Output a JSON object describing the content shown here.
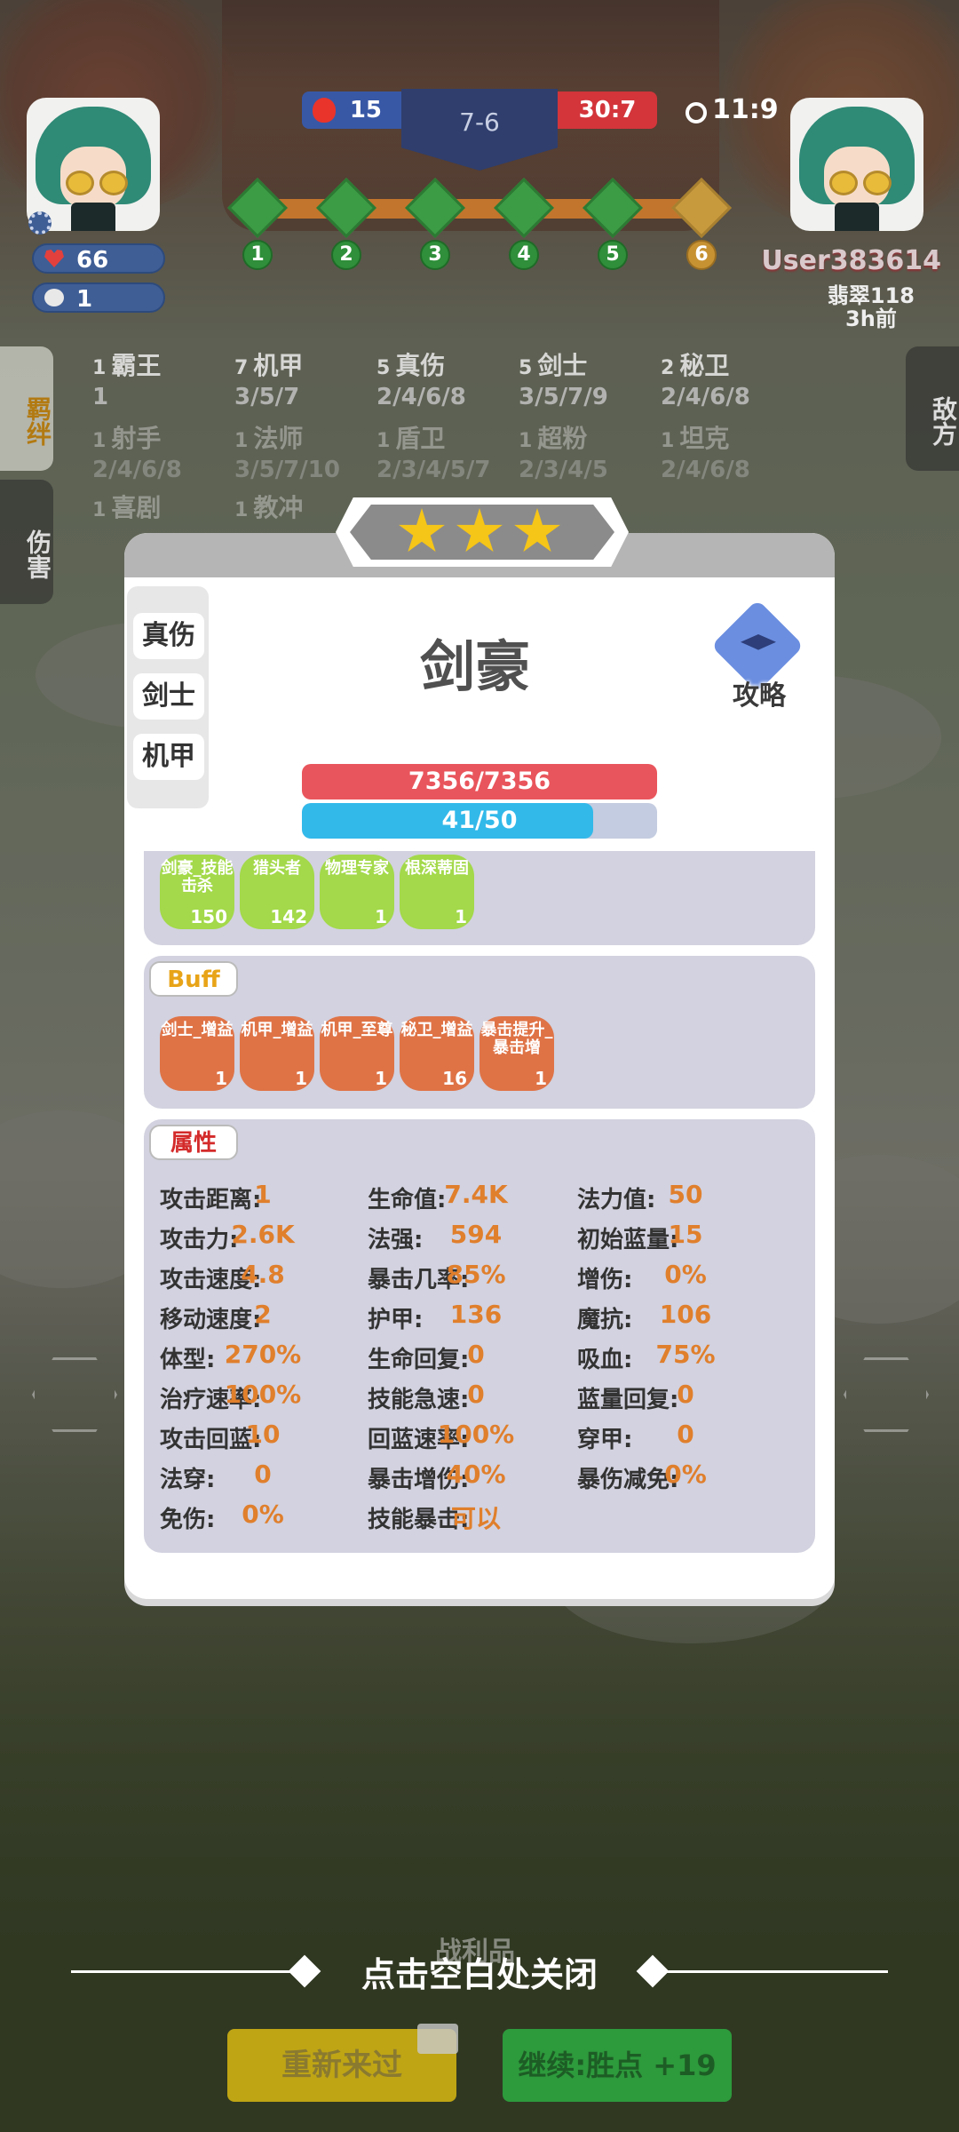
{
  "hud": {
    "left_hp": "66",
    "left_coins": "1",
    "score_left": "15",
    "round": "7-6",
    "score_right": "30:7",
    "timer": "11:9",
    "progress_steps": [
      "1",
      "2",
      "3",
      "4",
      "5",
      "6"
    ],
    "enemy_name": "User383614",
    "enemy_rank": "翡翠118",
    "enemy_time": "3h前"
  },
  "side_tabs": {
    "synergy": "羁绊",
    "damage": "伤害",
    "enemy": "敌方"
  },
  "synergies": [
    {
      "count": "1",
      "name": "霸王",
      "levels": "1"
    },
    {
      "count": "7",
      "name": "机甲",
      "levels": "3/5/7"
    },
    {
      "count": "5",
      "name": "真伤",
      "levels": "2/4/6/8"
    },
    {
      "count": "5",
      "name": "剑士",
      "levels": "3/5/7/9"
    },
    {
      "count": "2",
      "name": "秘卫",
      "levels": "2/4/6/8"
    },
    {
      "count": "1",
      "name": "射手",
      "levels": "2/4/6/8"
    },
    {
      "count": "1",
      "name": "法师",
      "levels": "3/5/7/10"
    },
    {
      "count": "1",
      "name": "盾卫",
      "levels": "2/3/4/5/7"
    },
    {
      "count": "1",
      "name": "超粉",
      "levels": "2/3/4/5"
    },
    {
      "count": "1",
      "name": "坦克",
      "levels": "2/4/6/8"
    },
    {
      "count": "1",
      "name": "喜剧",
      "levels": ""
    },
    {
      "count": "1",
      "name": "教冲",
      "levels": ""
    }
  ],
  "hero": {
    "name": "剑豪",
    "traits": [
      "真伤",
      "剑士",
      "机甲"
    ],
    "guide_label": "攻略",
    "hp_text": "7356/7356",
    "mana_text": "41/50",
    "mana_fraction": 0.82
  },
  "skills": [
    {
      "name": "剑豪_技能击杀",
      "count": "150"
    },
    {
      "name": "猎头者",
      "count": "142"
    },
    {
      "name": "物理专家",
      "count": "1"
    },
    {
      "name": "根深蒂固",
      "count": "1"
    }
  ],
  "buff_title": "Buff",
  "buffs": [
    {
      "name": "剑士_增益",
      "count": "1"
    },
    {
      "name": "机甲_增益",
      "count": "1"
    },
    {
      "name": "机甲_至尊",
      "count": "1"
    },
    {
      "name": "秘卫_增益",
      "count": "16"
    },
    {
      "name": "暴击提升_暴击增",
      "count": "1"
    }
  ],
  "attr_title": "属性",
  "attributes": [
    [
      "攻击距离:",
      "1",
      "生命值:",
      "7.4K",
      "法力值:",
      "50"
    ],
    [
      "攻击力:",
      "2.6K",
      "法强:",
      "594",
      "初始蓝量:",
      "15"
    ],
    [
      "攻击速度:",
      "4.8",
      "暴击几率:",
      "85%",
      "增伤:",
      "0%"
    ],
    [
      "移动速度:",
      "2",
      "护甲:",
      "136",
      "魔抗:",
      "106"
    ],
    [
      "体型:",
      "270%",
      "生命回复:",
      "0",
      "吸血:",
      "75%"
    ],
    [
      "治疗速率:",
      "100%",
      "技能急速:",
      "0",
      "蓝量回复:",
      "0"
    ],
    [
      "攻击回蓝:",
      "10",
      "回蓝速率:",
      "100%",
      "穿甲:",
      "0"
    ],
    [
      "法穿:",
      "0",
      "暴击增伤:",
      "40%",
      "暴伤减免:",
      "0%"
    ],
    [
      "免伤:",
      "0%",
      "技能暴击:",
      "可以",
      "",
      ""
    ]
  ],
  "bottom": {
    "close_hint": "点击空白处关闭",
    "loot_label": "战利品",
    "retry_label": "重新来过",
    "continue_label": "继续:胜点 +19"
  },
  "colors": {
    "hp_bar": "#e9555c",
    "mana_bar": "#32b9ea",
    "skill_green": "#a3d94a",
    "buff_orange": "#df7346",
    "attr_value": "#e07f2c"
  }
}
